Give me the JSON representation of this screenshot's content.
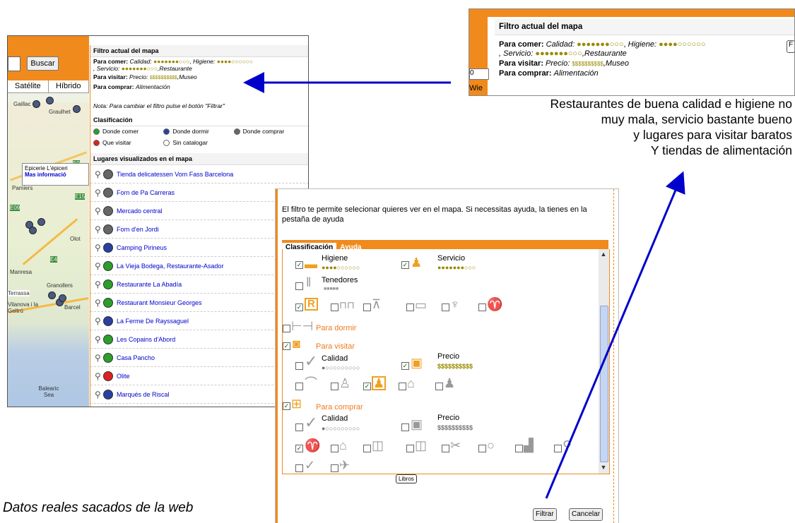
{
  "colors": {
    "accent": "#f08a1c",
    "arrow": "#0000cc",
    "link": "#0000cc"
  },
  "shotA": {
    "search_button": "Buscar",
    "map_tabs": [
      "Satélite",
      "Híbrido"
    ],
    "map_labels": [
      "Gaillac",
      "Graulhet",
      "Pamiers",
      "E09",
      "Balearic Sea",
      "Manresa",
      "Terrassa",
      "Granollers",
      "Vilanova i la Geltrú",
      "Barcel",
      "E9",
      "Olot",
      "E4",
      "E15"
    ],
    "popup": {
      "line1": "Epicerie L'épiceri",
      "link": "Mas informació"
    },
    "filter_title": "Filtro actual del mapa",
    "filter": {
      "comer_label": "Para comer:",
      "calidad": "Calidad:",
      "calidad_dots": "●●●●●●●○○○",
      "higiene": "Higiene:",
      "higiene_dots": "●●●●○○○○○○",
      "servicio": ", Servicio:",
      "servicio_dots": "●●●●●●●○○○",
      "restaurante": ",Restaurante",
      "visitar_label": "Para visitar:",
      "precio": "Precio:",
      "precio_dots": "$$$$$$$$$$",
      "museo": ",Museo",
      "comprar_label": "Para comprar:",
      "alimentacion": "Alimentación",
      "nota": "Nota: Para cambiar el filtro pulse el botón \"Filtrar\""
    },
    "clasif_title": "Clasificación",
    "legend": [
      {
        "label": "Donde comer",
        "color": "#2aa02a"
      },
      {
        "label": "Donde dormir",
        "color": "#2a3fa0"
      },
      {
        "label": "Donde comprar",
        "color": "#666666"
      },
      {
        "label": "Que visitar",
        "color": "#e02020"
      },
      {
        "label": "Sin catalogar",
        "color": "#ffffff"
      }
    ],
    "places_title": "Lugares visualizados en el mapa",
    "places": [
      {
        "name": "Tienda delicatessen Vom Fass Barcelona",
        "color": "#666666"
      },
      {
        "name": "Forn de Pa Carreras",
        "color": "#666666"
      },
      {
        "name": "Mercado central",
        "color": "#666666"
      },
      {
        "name": "Forn d'en Jordi",
        "color": "#666666"
      },
      {
        "name": "Camping Pirineus",
        "color": "#2a3fa0"
      },
      {
        "name": "La Vieja Bodega, Restaurante-Asador",
        "color": "#2aa02a"
      },
      {
        "name": "Restaurante La Abadía",
        "color": "#2aa02a"
      },
      {
        "name": "Restaurant Monsieur Georges",
        "color": "#2aa02a"
      },
      {
        "name": "La Ferme De Rayssaguel",
        "color": "#2a3fa0"
      },
      {
        "name": "Les Copains d'Abord",
        "color": "#2aa02a"
      },
      {
        "name": "Casa Pancho",
        "color": "#2aa02a"
      },
      {
        "name": "Olite",
        "color": "#e02020"
      },
      {
        "name": "Marqués de Riscal",
        "color": "#2a3fa0"
      }
    ]
  },
  "shotB": {
    "title": "Filtro actual del mapa",
    "comer_label": "Para comer:",
    "calidad": "Calidad:",
    "calidad_dots": "●●●●●●●○○○",
    "higiene": "Higiene:",
    "higiene_dots": "●●●●○○○○○○",
    "servicio": ", Servicio:",
    "servicio_dots": "●●●●●●●○○○",
    "restaurante": ",Restaurante",
    "visitar_label": "Para visitar:",
    "precio": "Precio:",
    "precio_dots": "$$$$$$$$$$",
    "museo": ",Museo",
    "comprar_label": "Para comprar:",
    "alimentacion": "Alimentación",
    "edge_f": "F",
    "edge_0": "0",
    "edge_wie": "Wie"
  },
  "caption": [
    "Restaurantes de buena calidad e higiene no",
    "muy mala, servicio bastante bueno",
    "y lugares para visitar baratos",
    "Y tiendas de alimentación"
  ],
  "dialog": {
    "intro": "El filtro te permite selecionar quieres ver en el mapa. Si necessitas ayuda, la tienes en la pestaña de ayuda",
    "tab_active": "Classificación",
    "tab_help": "Ayuda",
    "higiene": "Higiene",
    "higiene_dots": "●●●●○○○○○○",
    "servicio": "Servicio",
    "servicio_dots": "●●●●●●●○○○",
    "tenedores": "Tenedores",
    "tenedores_dots": "■■■■■",
    "dormir": "Para dormir",
    "visitar": "Para visitar",
    "calidad": "Calidad",
    "calidad_dots": "●○○○○○○○○○",
    "precio": "Precio",
    "precio_dots": "$$$$$$$$$$",
    "comprar": "Para comprar",
    "tooltip": "Libros",
    "filtrar": "Filtrar",
    "cancelar": "Cancelar"
  },
  "footer": "Datos reales sacados de la web"
}
